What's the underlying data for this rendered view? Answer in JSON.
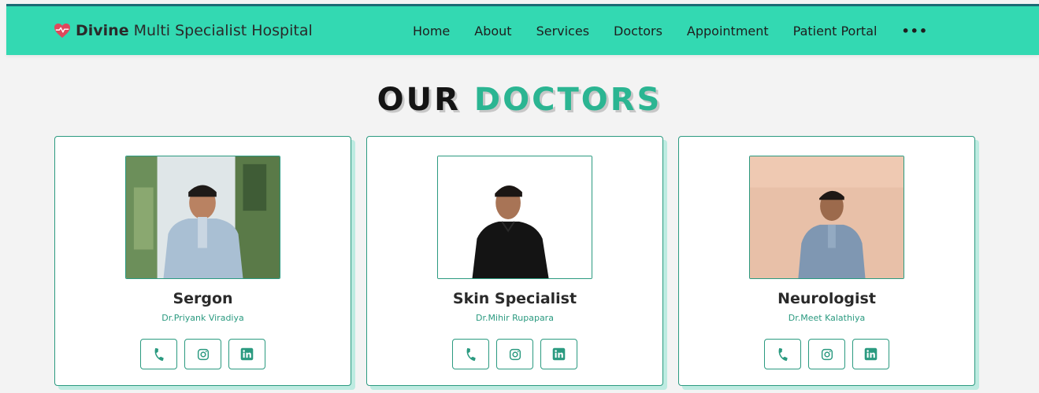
{
  "header": {
    "brand_strong": "Divine",
    "brand_rest": "Multi Specialist Hospital",
    "brand_icon": "heart-pulse-icon",
    "nav": [
      "Home",
      "About",
      "Services",
      "Doctors",
      "Appointment",
      "Patient Portal"
    ],
    "more_label": "•••"
  },
  "section": {
    "title_part1": "OUR",
    "title_part2": "DOCTORS"
  },
  "doctors": [
    {
      "specialty": "Sergon",
      "name": "Dr.Priyank Viradiya",
      "photo": "doctor-photo-kurta-outdoor"
    },
    {
      "specialty": "Skin Specialist",
      "name": "Dr.Mihir Rupapara",
      "photo": "doctor-photo-black-shirt"
    },
    {
      "specialty": "Neurologist",
      "name": "Dr.Meet Kalathiya",
      "photo": "doctor-photo-indoor-beige"
    }
  ],
  "social_icons": [
    "phone-icon",
    "instagram-icon",
    "linkedin-icon"
  ],
  "colors": {
    "nav_bg": "#33d9b2",
    "accent": "#2bb592",
    "card_border": "#2b9a80",
    "heart": "#e0485c",
    "page_bg": "#f3f3f3"
  }
}
